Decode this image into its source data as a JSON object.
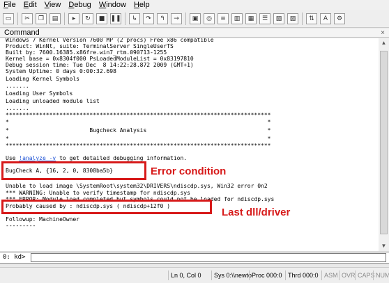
{
  "menu": [
    {
      "label": "File",
      "key": "F",
      "rest": "ile"
    },
    {
      "label": "Edit",
      "key": "E",
      "rest": "dit"
    },
    {
      "label": "View",
      "key": "V",
      "rest": "iew"
    },
    {
      "label": "Debug",
      "key": "D",
      "rest": "ebug"
    },
    {
      "label": "Window",
      "key": "W",
      "rest": "indow"
    },
    {
      "label": "Help",
      "key": "H",
      "rest": "elp"
    }
  ],
  "window": {
    "title": "Command",
    "close": "×"
  },
  "output": {
    "lines": [
      "Windows 7 Kernel Version 7600 MP (2 procs) Free x86 compatible",
      "Product: WinNt, suite: TerminalServer SingleUserTS",
      "Built by: 7600.16385.x86fre.win7_rtm.090713-1255",
      "Kernel base = 0x8304f000 PsLoadedModuleList = 0x83197810",
      "Debug session time: Tue Dec  8 14:22:28.872 2009 (GMT+1)",
      "System Uptime: 0 days 0:00:32.698",
      "Loading Kernel Symbols",
      ".......",
      "Loading User Symbols",
      "Loading unloaded module list",
      ".......",
      "*******************************************************************************",
      "*                                                                             *",
      "*                        Bugcheck Analysis                                    *",
      "*                                                                             *",
      "*******************************************************************************"
    ],
    "use_prefix": "Use ",
    "analyze_link": "!analyze -v",
    "use_suffix": " to get detailed debugging information.",
    "bugcheck": "BugCheck A, {16, 2, 0, 8308ba5b}",
    "error_lines": [
      "Unable to load image \\SystemRoot\\system32\\DRIVERS\\ndiscdp.sys, Win32 error 0n2",
      "*** WARNING: Unable to verify timestamp for ndiscdp.sys",
      "*** ERROR: Module load completed but symbols could not be loaded for ndiscdp.sys"
    ],
    "probably": "Probably caused by : ndiscdp.sys ( ndiscdp+12f0 )",
    "followup": "Followup: MachineOwner",
    "dashes": "---------"
  },
  "annotations": {
    "error_condition": "Error condition",
    "last_driver": "Last dll/driver"
  },
  "command": {
    "prompt": "0: kd>",
    "value": ""
  },
  "status": {
    "ln_col": "Ln 0, Col 0",
    "sys": "Sys 0:\\\\newto",
    "proc": "Proc 000:0",
    "thrd": "Thrd 000:0",
    "asm": "ASM",
    "ovr": "OVR",
    "caps": "CAPS",
    "num": "NUM"
  },
  "colors": {
    "annotation": "#d71a1a",
    "link": "#1f54d6"
  }
}
